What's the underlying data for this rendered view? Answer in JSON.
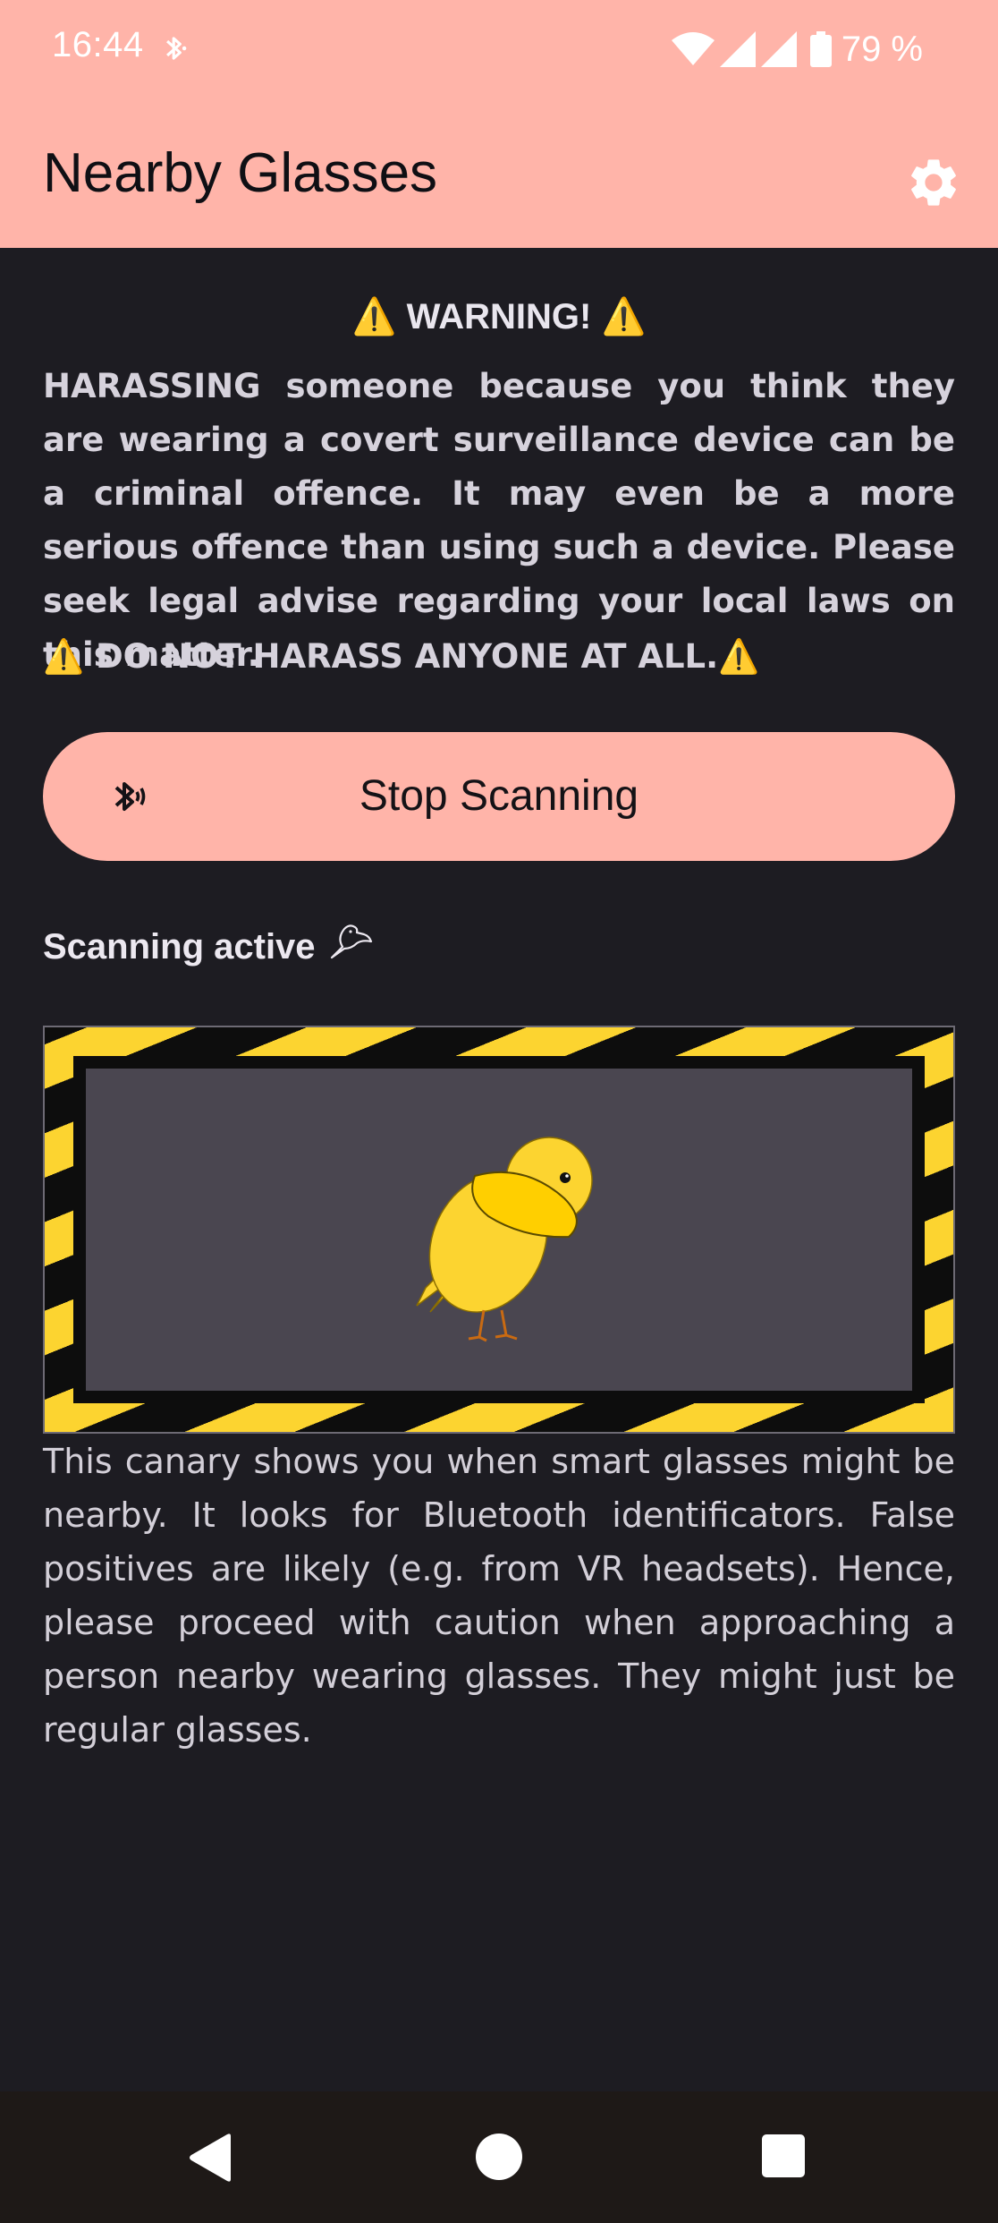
{
  "status_bar": {
    "time": "16:44",
    "battery": "79 %",
    "icons": [
      "bluetooth-icon",
      "wifi-icon",
      "signal-icon",
      "signal-icon",
      "battery-icon"
    ]
  },
  "app_bar": {
    "title": "Nearby Glasses",
    "settings_icon": "gear-icon"
  },
  "warning": {
    "glyph": "⚠️",
    "title": "WARNING!",
    "body": "HARASSING someone because you think they are wearing a covert surveillance device can be a criminal offence. It may even be a more serious offence than using such a device. Please seek legal advise regarding your local laws on this matter.",
    "footer": "DO NOT HARASS ANYONE AT ALL."
  },
  "scan_button": {
    "label": "Stop Scanning",
    "icon": "bluetooth-searching-icon"
  },
  "scan_status": {
    "text": "Scanning active",
    "icon": "bird-icon"
  },
  "canary": {
    "icon": "canary-illustration",
    "stripe_colors": [
      "#fcd430",
      "#0d0d0d"
    ],
    "screen_color": "#4a4650"
  },
  "description": "This canary shows you when smart glasses might be nearby. It looks for Bluetooth identificators. False positives are likely (e.g. from VR headsets). Hence, please proceed with caution when approaching a person nearby wearing glasses. They might just be regular glasses.",
  "nav_bar": {
    "icons": [
      "back-icon",
      "home-icon",
      "recents-icon"
    ]
  },
  "colors": {
    "accent": "#ffb4a9",
    "background": "#1d1c22",
    "warning": "#f6c83a"
  }
}
